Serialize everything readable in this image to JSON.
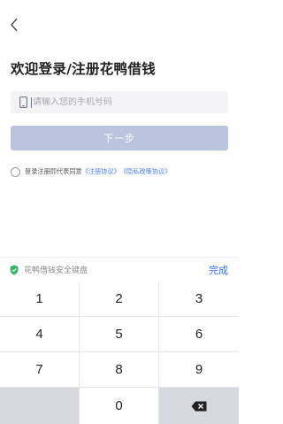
{
  "header": {
    "back_icon": "chevron-left-icon",
    "title": "欢迎登录/注册花鸭借钱"
  },
  "phone": {
    "icon": "phone-icon",
    "placeholder": "请输入您的手机号码",
    "value": ""
  },
  "next_button": {
    "label": "下一步",
    "color": "#b9c4de"
  },
  "agreement": {
    "checked": false,
    "text": "登录注册即代表同意",
    "link_terms": "《注册协议》",
    "link_privacy": "《隐私政策协议》",
    "link_color": "#4a7cff"
  },
  "keyboard": {
    "shield_icon": "shield-check-icon",
    "title": "花鸭借钱安全键盘",
    "done_label": "完成",
    "keys": [
      "1",
      "2",
      "3",
      "4",
      "5",
      "6",
      "7",
      "8",
      "9",
      "",
      "0",
      ""
    ],
    "delete_icon": "backspace-icon"
  }
}
